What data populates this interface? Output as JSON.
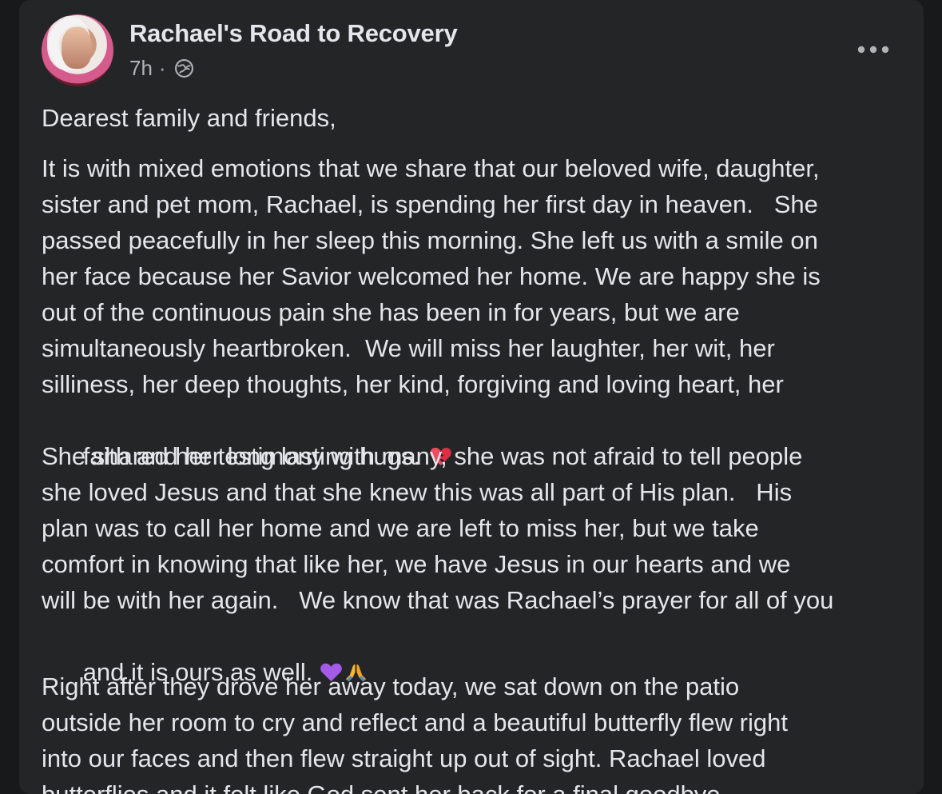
{
  "post": {
    "author": "Rachael's Road to Recovery",
    "timestamp": "7h",
    "separator": "·",
    "privacy_icon": "globe-icon",
    "more_icon": "more-horizontal-icon",
    "lines": {
      "l1": "Dearest family and friends,",
      "l2": "It is with mixed emotions that we share that our beloved wife, daughter,",
      "l3": "sister and pet mom, Rachael, is spending her first day in heaven.   She",
      "l4": "passed peacefully in her sleep this morning. She left us with a smile on",
      "l5": "her face because her Savior welcomed her home. We are happy she is",
      "l6": "out of the continuous pain she has been in for years, but we are",
      "l7": "simultaneously heartbroken.  We will miss her laughter, her wit, her",
      "l8": "silliness, her deep thoughts, her kind, forgiving and loving heart, her",
      "l9": "faith and her long lasting hugs.",
      "l10": "She shared her testimony with many, she was not afraid to tell people",
      "l11": "she loved Jesus and that she knew this was all part of His plan.   His",
      "l12": "plan was to call her home and we are left to miss her, but we take",
      "l13": "comfort in knowing that like her, we have Jesus in our hearts and we",
      "l14": "will be with her again.   We know that was Rachael’s prayer for all of you",
      "l15": "and it is ours as well.",
      "l16": "Right after they drove her away today, we sat down on the patio",
      "l17": "outside her room to cry and reflect and a beautiful butterfly flew right",
      "l18": "into our faces and then flew straight up out of sight. Rachael loved",
      "l19": "butterflies and it felt like God sent her back for a final goodbye."
    },
    "emojis": {
      "broken_heart": "broken-heart-icon",
      "purple_heart": "purple-heart-icon",
      "praying_hands": "praying-hands-icon"
    },
    "colors": {
      "background": "#18191a",
      "card": "#242526",
      "text": "#e4e6eb",
      "secondary_text": "#b0b3b8"
    }
  }
}
